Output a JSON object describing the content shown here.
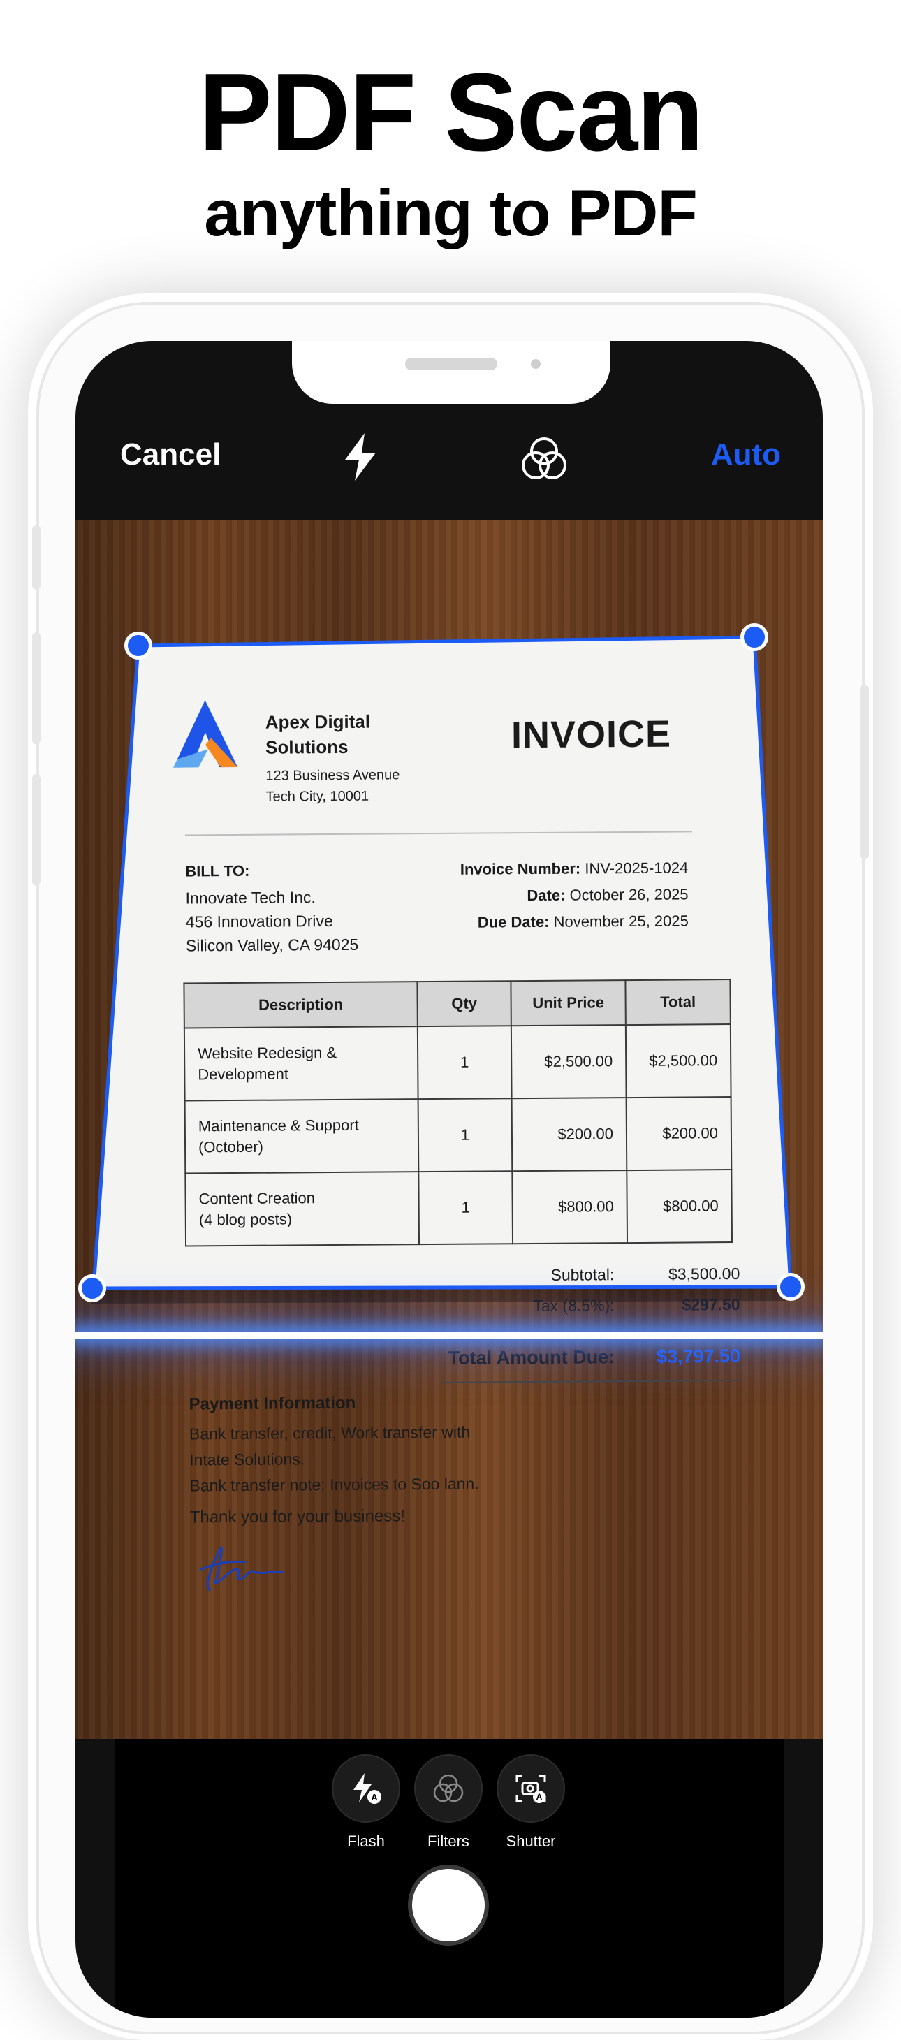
{
  "promo": {
    "headline": "PDF Scan",
    "subline": "anything to PDF"
  },
  "camera_top_bar": {
    "cancel_label": "Cancel",
    "flash_icon": "bolt-icon",
    "filters_icon": "three-circles-icon",
    "mode_label": "Auto",
    "accent_color": "#1d5bf5"
  },
  "document": {
    "company_name": "Apex Digital Solutions",
    "company_address_line1": "123 Business Avenue",
    "company_address_line2": "Tech City, 10001",
    "title": "INVOICE",
    "bill_to_heading": "BILL TO:",
    "bill_to_lines": [
      "Innovate Tech Inc.",
      "456 Innovation Drive",
      "Silicon Valley, CA 94025"
    ],
    "meta": [
      {
        "label": "Invoice Number:",
        "value": "INV-2025-1024"
      },
      {
        "label": "Date:",
        "value": "October 26, 2025"
      },
      {
        "label": "Due Date:",
        "value": "November 25, 2025"
      }
    ],
    "table_headers": [
      "Description",
      "Qty",
      "Unit Price",
      "Total"
    ],
    "rows": [
      {
        "desc_line1": "Website Redesign &",
        "desc_line2": "Development",
        "qty": "1",
        "unit": "$2,500.00",
        "total": "$2,500.00"
      },
      {
        "desc_line1": "Maintenance & Support",
        "desc_line2": "(October)",
        "qty": "1",
        "unit": "$200.00",
        "total": "$200.00"
      },
      {
        "desc_line1": "Content Creation",
        "desc_line2": "(4 blog posts)",
        "qty": "1",
        "unit": "$800.00",
        "total": "$800.00"
      }
    ],
    "subtotal_label": "Subtotal:",
    "subtotal_value": "$3,500.00",
    "tax_label": "Tax (8.5%):",
    "tax_value": "$297.50",
    "total_label": "Total Amount Due:",
    "total_value": "$3,797.50",
    "payment_heading": "Payment Information",
    "payment_lines": [
      "Bank transfer, credit, Work transfer with",
      "Intate Solutions.",
      "Bank transfer note: Invoices to Soo lann."
    ],
    "thanks": "Thank you for your business!"
  },
  "bottom_controls": {
    "items": [
      {
        "label": "Flash",
        "icon": "auto-flash-icon"
      },
      {
        "label": "Filters",
        "icon": "filters-icon"
      },
      {
        "label": "Shutter",
        "icon": "auto-shutter-icon"
      }
    ]
  }
}
